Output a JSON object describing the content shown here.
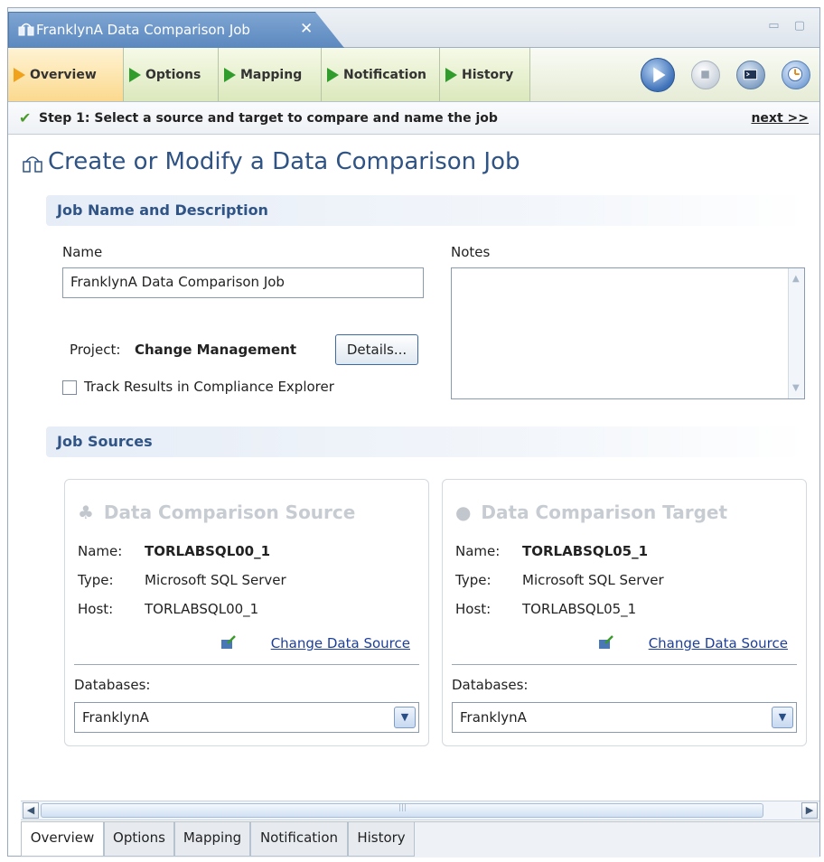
{
  "window": {
    "tab_title": "FranklynA Data Comparison Job",
    "close_glyph": "✕",
    "window_controls": "▭ ▢"
  },
  "steps": [
    {
      "label": "Overview",
      "active": true
    },
    {
      "label": "Options",
      "active": false
    },
    {
      "label": "Mapping",
      "active": false
    },
    {
      "label": "Notification",
      "active": false
    },
    {
      "label": "History",
      "active": false
    }
  ],
  "toolbar_icons": [
    "run-job-icon",
    "stop-job-icon",
    "terminal-icon",
    "schedule-icon"
  ],
  "step_message": {
    "text": "Step 1: Select a source and target to compare and name the job",
    "next_link": "next >>"
  },
  "page": {
    "title": "Create or Modify a Data Comparison Job"
  },
  "job_name_section": {
    "heading": "Job Name and Description",
    "name_label": "Name",
    "name_value": "FranklynA Data Comparison Job",
    "notes_label": "Notes",
    "notes_value": "",
    "project_label": "Project:",
    "project_value": "Change Management",
    "details_button": "Details...",
    "track_label": "Track Results in Compliance Explorer",
    "track_checked": false
  },
  "job_sources_section": {
    "heading": "Job Sources",
    "source": {
      "title": "Data Comparison Source",
      "name_label": "Name:",
      "name_value": "TORLABSQL00_1",
      "type_label": "Type:",
      "type_value": "Microsoft SQL Server",
      "host_label": "Host:",
      "host_value": "TORLABSQL00_1",
      "change_link": "Change Data Source",
      "databases_label": "Databases:",
      "database_value": "FranklynA"
    },
    "target": {
      "title": "Data Comparison Target",
      "name_label": "Name:",
      "name_value": "TORLABSQL05_1",
      "type_label": "Type:",
      "type_value": "Microsoft SQL Server",
      "host_label": "Host:",
      "host_value": "TORLABSQL05_1",
      "change_link": "Change Data Source",
      "databases_label": "Databases:",
      "database_value": "FranklynA"
    }
  },
  "bottom_tabs": [
    {
      "label": "Overview",
      "active": true
    },
    {
      "label": "Options",
      "active": false
    },
    {
      "label": "Mapping",
      "active": false
    },
    {
      "label": "Notification",
      "active": false
    },
    {
      "label": "History",
      "active": false
    }
  ],
  "colors": {
    "accent_blue": "#2e5384",
    "section_text": "#2f5485",
    "step_green": "#2f9c2c",
    "step_active_orange": "#f0a21a",
    "link_blue": "#1d3f9a"
  }
}
